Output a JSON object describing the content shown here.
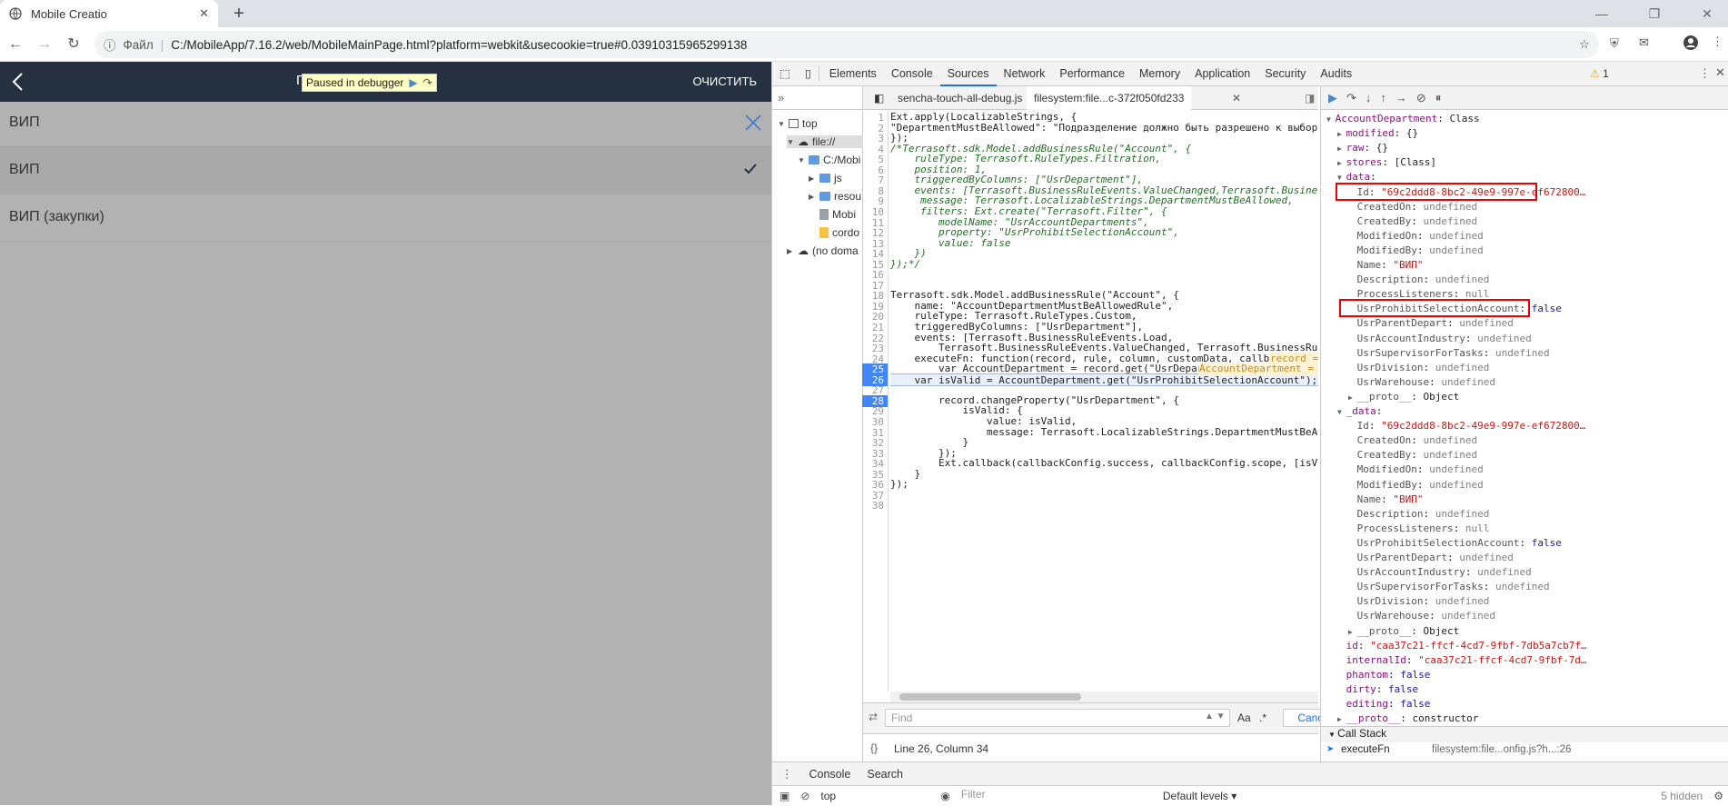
{
  "browser": {
    "tab_title": "Mobile Creatio",
    "new_tab_label": "+",
    "address_prefix": "Файл",
    "address_sep": "|",
    "url": "C:/MobileApp/7.16.2/web/MobileMainPage.html?platform=webkit&usecookie=true#0.03910315965299138"
  },
  "app": {
    "clear_label": "ОЧИСТИТЬ",
    "title_partial": "П",
    "paused_label": "Paused in debugger",
    "search_value": "ВИП",
    "items": [
      {
        "label": "ВИП",
        "selected": true
      },
      {
        "label": "ВИП (закупки)",
        "selected": false
      }
    ]
  },
  "devtools": {
    "tabs": [
      "Elements",
      "Console",
      "Sources",
      "Network",
      "Performance",
      "Memory",
      "Application",
      "Security",
      "Audits"
    ],
    "active_tab": "Sources",
    "warning_count": "1",
    "navigator": {
      "nodes": [
        {
          "label": "top",
          "kind": "frame"
        },
        {
          "label": "file://",
          "kind": "cloud"
        },
        {
          "label": "C:/Mobi",
          "kind": "folder"
        },
        {
          "label": "js",
          "kind": "folder"
        },
        {
          "label": "resou",
          "kind": "folder"
        },
        {
          "label": "Mobi",
          "kind": "file"
        },
        {
          "label": "cordo",
          "kind": "file"
        },
        {
          "label": "(no doma",
          "kind": "cloud"
        }
      ]
    },
    "editor_tabs": [
      "sencha-touch-all-debug.js",
      "filesystem:file...c-372f050fd233"
    ],
    "code_lines": [
      "Ext.apply(LocalizableStrings, {",
      "\"DepartmentMustBeAllowed\": \"Подразделение должно быть разрешено к выбору\"",
      "});",
      "/*Terrasoft.sdk.Model.addBusinessRule(\"Account\", {",
      "    ruleType: Terrasoft.RuleTypes.Filtration,",
      "    position: 1,",
      "    triggeredByColumns: [\"UsrDepartment\"],",
      "    events: [Terrasoft.BusinessRuleEvents.ValueChanged,Terrasoft.BusinessRuleEvents.Load],",
      "     message: Terrasoft.LocalizableStrings.DepartmentMustBeAllowed,",
      "     filters: Ext.create(\"Terrasoft.Filter\", {",
      "        modelName: \"UsrAccountDepartments\",",
      "        property: \"UsrProhibitSelectionAccount\",",
      "        value: false",
      "    })",
      "});*/",
      "",
      "",
      "Terrasoft.sdk.Model.addBusinessRule(\"Account\", {",
      "    name: \"AccountDepartmentMustBeAllowedRule\",",
      "    ruleType: Terrasoft.RuleTypes.Custom,",
      "    triggeredByColumns: [\"UsrDepartment\"],",
      "    events: [Terrasoft.BusinessRuleEvents.Load,",
      "        Terrasoft.BusinessRuleEvents.ValueChanged, Terrasoft.BusinessRuleEvents.Save],",
      "    executeFn: function(record, rule, column, customData, callbackConfig) {",
      "        var AccountDepartment = record.get(\"UsrDepartment\");",
      "    var isValid = AccountDepartment.get(\"UsrProhibitSelectionAccount\");",
      "",
      "        record.changeProperty(\"UsrDepartment\", {",
      "            isValid: {",
      "                value: isValid,",
      "                message: Terrasoft.LocalizableStrings.DepartmentMustBeAllowed",
      "            }",
      "        });",
      "        Ext.callback(callbackConfig.success, callbackConfig.scope, [isValid]);",
      "    }",
      "});",
      "",
      ""
    ],
    "line_numbers": [
      "1",
      "2",
      "3",
      "4",
      "5",
      "6",
      "7",
      "8",
      "9",
      "10",
      "11",
      "12",
      "13",
      "14",
      "15",
      "16",
      "17",
      "18",
      "19",
      "20",
      "21",
      "22",
      "23",
      "24",
      "25",
      "26",
      "27",
      "28",
      "29",
      "30",
      "31",
      "32",
      "33",
      "34",
      "35",
      "36",
      "37",
      "38"
    ],
    "inline_value_24": "record = Class",
    "inline_value_25": "AccountDepartment = Class {mo",
    "find_placeholder": "Find",
    "find_aa": "Aa",
    "find_regex": ".*",
    "cancel_label": "Cancel",
    "status_text": "Line 26, Column 34",
    "scope_lines": [
      {
        "k": "AccountDepartment",
        "v": "Class",
        "indent": 0,
        "type": "obj"
      },
      {
        "k": "modified",
        "v": "{}",
        "indent": 1,
        "type": "obj"
      },
      {
        "k": "raw",
        "v": "{}",
        "indent": 1,
        "type": "obj"
      },
      {
        "k": "stores",
        "v": "[Class]",
        "indent": 1,
        "type": "obj"
      },
      {
        "k": "data",
        "v": "",
        "indent": 1,
        "type": "obj"
      },
      {
        "k": "Id",
        "v": "\"69c2ddd8-8bc2-49e9-997e-ef672800…",
        "indent": 2,
        "type": "str"
      },
      {
        "k": "CreatedOn",
        "v": "undefined",
        "indent": 2,
        "type": "undef"
      },
      {
        "k": "CreatedBy",
        "v": "undefined",
        "indent": 2,
        "type": "undef"
      },
      {
        "k": "ModifiedOn",
        "v": "undefined",
        "indent": 2,
        "type": "undef"
      },
      {
        "k": "ModifiedBy",
        "v": "undefined",
        "indent": 2,
        "type": "undef"
      },
      {
        "k": "Name",
        "v": "\"ВИП\"",
        "indent": 2,
        "type": "str"
      },
      {
        "k": "Description",
        "v": "undefined",
        "indent": 2,
        "type": "undef"
      },
      {
        "k": "ProcessListeners",
        "v": "null",
        "indent": 2,
        "type": "undef"
      },
      {
        "k": "UsrProhibitSelectionAccount",
        "v": "false",
        "indent": 2,
        "type": "bool"
      },
      {
        "k": "UsrParentDepart",
        "v": "undefined",
        "indent": 2,
        "type": "undef"
      },
      {
        "k": "UsrAccountIndustry",
        "v": "undefined",
        "indent": 2,
        "type": "undef"
      },
      {
        "k": "UsrSupervisorForTasks",
        "v": "undefined",
        "indent": 2,
        "type": "undef"
      },
      {
        "k": "UsrDivision",
        "v": "undefined",
        "indent": 2,
        "type": "undef"
      },
      {
        "k": "UsrWarehouse",
        "v": "undefined",
        "indent": 2,
        "type": "undef"
      },
      {
        "k": "__proto__",
        "v": "Object",
        "indent": 2,
        "type": "obj"
      },
      {
        "k": "_data",
        "v": "",
        "indent": 1,
        "type": "obj"
      },
      {
        "k": "Id",
        "v": "\"69c2ddd8-8bc2-49e9-997e-ef672800…",
        "indent": 2,
        "type": "str"
      },
      {
        "k": "CreatedOn",
        "v": "undefined",
        "indent": 2,
        "type": "undef"
      },
      {
        "k": "CreatedBy",
        "v": "undefined",
        "indent": 2,
        "type": "undef"
      },
      {
        "k": "ModifiedOn",
        "v": "undefined",
        "indent": 2,
        "type": "undef"
      },
      {
        "k": "ModifiedBy",
        "v": "undefined",
        "indent": 2,
        "type": "undef"
      },
      {
        "k": "Name",
        "v": "\"ВИП\"",
        "indent": 2,
        "type": "str"
      },
      {
        "k": "Description",
        "v": "undefined",
        "indent": 2,
        "type": "undef"
      },
      {
        "k": "ProcessListeners",
        "v": "null",
        "indent": 2,
        "type": "undef"
      },
      {
        "k": "UsrProhibitSelectionAccount",
        "v": "false",
        "indent": 2,
        "type": "bool"
      },
      {
        "k": "UsrParentDepart",
        "v": "undefined",
        "indent": 2,
        "type": "undef"
      },
      {
        "k": "UsrAccountIndustry",
        "v": "undefined",
        "indent": 2,
        "type": "undef"
      },
      {
        "k": "UsrSupervisorForTasks",
        "v": "undefined",
        "indent": 2,
        "type": "undef"
      },
      {
        "k": "UsrDivision",
        "v": "undefined",
        "indent": 2,
        "type": "undef"
      },
      {
        "k": "UsrWarehouse",
        "v": "undefined",
        "indent": 2,
        "type": "undef"
      },
      {
        "k": "__proto__",
        "v": "Object",
        "indent": 2,
        "type": "obj"
      },
      {
        "k": "id",
        "v": "\"caa37c21-ffcf-4cd7-9fbf-7db5a7cb7f…",
        "indent": 1,
        "type": "str"
      },
      {
        "k": "internalId",
        "v": "\"caa37c21-ffcf-4cd7-9fbf-7d…",
        "indent": 1,
        "type": "str"
      },
      {
        "k": "phantom",
        "v": "false",
        "indent": 1,
        "type": "bool"
      },
      {
        "k": "dirty",
        "v": "false",
        "indent": 1,
        "type": "bool"
      },
      {
        "k": "editing",
        "v": "false",
        "indent": 1,
        "type": "bool"
      },
      {
        "k": "__proto__",
        "v": "constructor",
        "indent": 1,
        "type": "obj"
      }
    ],
    "call_stack_label": "Call Stack",
    "call_stack_fn": "executeFn",
    "call_stack_loc": "filesystem:file...onfig.js?h...:26",
    "drawer_tabs": [
      "Console",
      "Search"
    ],
    "console_context": "top",
    "filter_placeholder": "Filter",
    "levels_label": "Default levels ▾",
    "hidden_label": "5 hidden"
  }
}
